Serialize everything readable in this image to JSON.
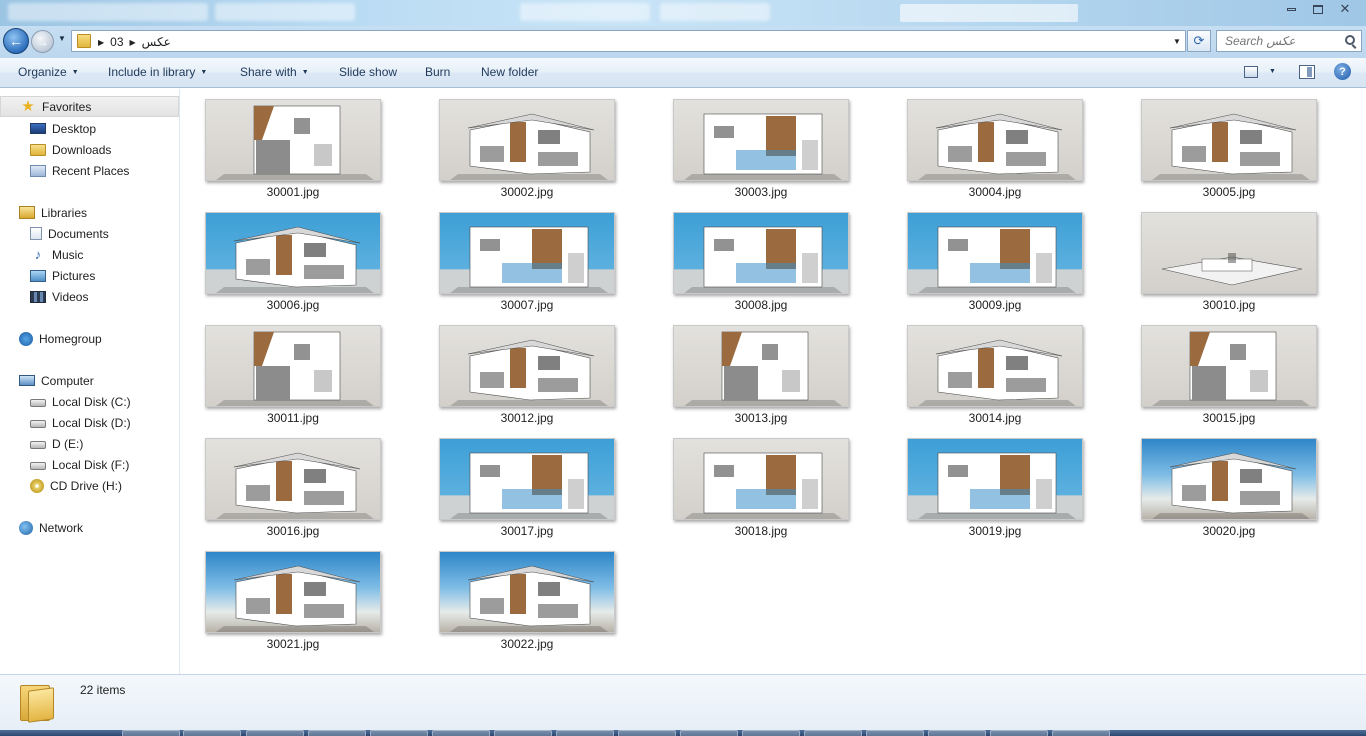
{
  "window": {
    "controls": [
      "minimize",
      "maximize",
      "close"
    ]
  },
  "address": {
    "breadcrumbs": [
      "03",
      "عکس"
    ],
    "search_placeholder": "Search عکس"
  },
  "toolbar": {
    "organize": "Organize",
    "include_in_library": "Include in library",
    "share_with": "Share with",
    "slide_show": "Slide show",
    "burn": "Burn",
    "new_folder": "New folder"
  },
  "nav": {
    "favorites": "Favorites",
    "desktop": "Desktop",
    "downloads": "Downloads",
    "recent_places": "Recent Places",
    "libraries": "Libraries",
    "documents": "Documents",
    "music": "Music",
    "pictures": "Pictures",
    "videos": "Videos",
    "homegroup": "Homegroup",
    "computer": "Computer",
    "local_c": "Local Disk (C:)",
    "local_d": "Local Disk (D:)",
    "drive_e": "D (E:)",
    "local_f": "Local Disk (F:)",
    "cd_drive": "CD Drive (H:)",
    "network": "Network"
  },
  "files": [
    {
      "name": "30001.jpg",
      "bg": "gray"
    },
    {
      "name": "30002.jpg",
      "bg": "gray"
    },
    {
      "name": "30003.jpg",
      "bg": "gray"
    },
    {
      "name": "30004.jpg",
      "bg": "gray"
    },
    {
      "name": "30005.jpg",
      "bg": "gray"
    },
    {
      "name": "30006.jpg",
      "bg": "blue"
    },
    {
      "name": "30007.jpg",
      "bg": "blue"
    },
    {
      "name": "30008.jpg",
      "bg": "blue"
    },
    {
      "name": "30009.jpg",
      "bg": "blue"
    },
    {
      "name": "30010.jpg",
      "bg": "gray"
    },
    {
      "name": "30011.jpg",
      "bg": "gray"
    },
    {
      "name": "30012.jpg",
      "bg": "gray"
    },
    {
      "name": "30013.jpg",
      "bg": "gray"
    },
    {
      "name": "30014.jpg",
      "bg": "gray"
    },
    {
      "name": "30015.jpg",
      "bg": "gray"
    },
    {
      "name": "30016.jpg",
      "bg": "gray"
    },
    {
      "name": "30017.jpg",
      "bg": "blue"
    },
    {
      "name": "30018.jpg",
      "bg": "gray"
    },
    {
      "name": "30019.jpg",
      "bg": "blue"
    },
    {
      "name": "30020.jpg",
      "bg": "photo"
    },
    {
      "name": "30021.jpg",
      "bg": "photo"
    },
    {
      "name": "30022.jpg",
      "bg": "photo"
    }
  ],
  "status": {
    "item_count": "22 items"
  },
  "colors": {
    "accent": "#1e395b",
    "sky_blue": "#3d9fd6",
    "wood": "#9b6a3f"
  }
}
